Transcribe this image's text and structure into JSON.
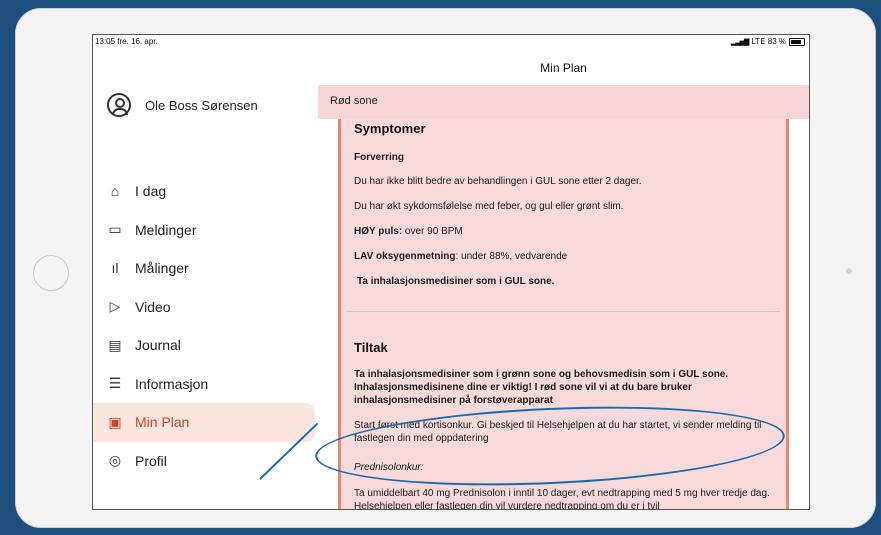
{
  "status_bar": {
    "time": "13:05",
    "date": "fre. 16. apr.",
    "network": "LTE 83 %"
  },
  "user": {
    "name": "Ole Boss Sørensen",
    "avatar_icon": "person-circle-icon"
  },
  "nav": [
    {
      "label": "I dag",
      "icon": "home-icon",
      "glyph": "⌂",
      "active": false
    },
    {
      "label": "Meldinger",
      "icon": "chat-icon",
      "glyph": "▭",
      "active": false
    },
    {
      "label": "Målinger",
      "icon": "bar-chart-icon",
      "glyph": "ıl",
      "active": false
    },
    {
      "label": "Video",
      "icon": "video-icon",
      "glyph": "▷",
      "active": false
    },
    {
      "label": "Journal",
      "icon": "clipboard-icon",
      "glyph": "▤",
      "active": false
    },
    {
      "label": "Informasjon",
      "icon": "document-icon",
      "glyph": "☰",
      "active": false
    },
    {
      "label": "Min Plan",
      "icon": "plan-icon",
      "glyph": "▣",
      "active": true
    },
    {
      "label": "Profil",
      "icon": "profile-icon",
      "glyph": "◎",
      "active": false
    }
  ],
  "main": {
    "title": "Min Plan",
    "zone": "Rød sone",
    "symptomer": {
      "heading": "Symptomer",
      "sub": "Forverring",
      "line1": "Du har ikke blitt bedre av behandlingen i GUL sone etter 2 dager.",
      "line2": "Du har økt sykdomsfølelse med feber, og gul eller grønt slim.",
      "puls_label": "HØY puls:",
      "puls_value": " over 90 BPM",
      "oksy_label": "LAV oksygenmetning",
      "oksy_value": ": under 88%, vedvarende",
      "medisin": "Ta inhalasjonsmedisiner som i GUL sone."
    },
    "tiltak": {
      "heading": "Tiltak",
      "bold_text": "Ta inhalasjonsmedisiner som i  grønn sone og behovsmedisin som i GUL sone. Inhalasjonsmedisinene dine er viktig! I rød sone vil vi at du bare bruker inhalasjonsmedisiner på forstøverapparat",
      "start_text": "Start først med kortisonkur. Gi beskjed til Helsehjelpen at du har startet, vi sender melding til fastlegen din med oppdatering",
      "prednisolon_label": "Prednisolonkur:",
      "prednisolon_text": "Ta umiddelbart 40 mg Prednisolon i inntil 10 dager, evt nedtrapping med 5 mg hver tredje dag. Helsehjelpen eller fastlegen din vil vurdere nedtrapping om du er i tvil"
    }
  },
  "colors": {
    "active": "#c5492f",
    "zone_bg": "#f5d5d6",
    "annotation": "#1b6bb3"
  }
}
